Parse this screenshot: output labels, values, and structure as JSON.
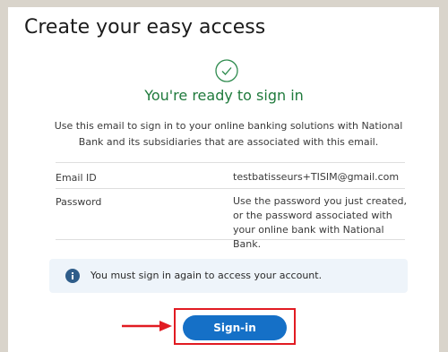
{
  "page": {
    "title": "Create your easy access"
  },
  "status": {
    "icon": "check-circle-icon",
    "heading": "You're ready to sign in",
    "color": "#1f7a3c"
  },
  "description": "Use this email to sign in to your online banking solutions with National Bank and its subsidiaries that are associated with this email.",
  "details": [
    {
      "label": "Email ID",
      "value": "testbatisseurs+TISIM@gmail.com"
    },
    {
      "label": "Password",
      "value": "Use the password you just created, or the password associated with your online bank with National Bank."
    }
  ],
  "notice": {
    "icon": "info-icon",
    "text": "You must sign in again to access your account."
  },
  "actions": {
    "signin_label": "Sign-in",
    "primary_color": "#1570c7",
    "highlight_color": "#e11b22"
  }
}
